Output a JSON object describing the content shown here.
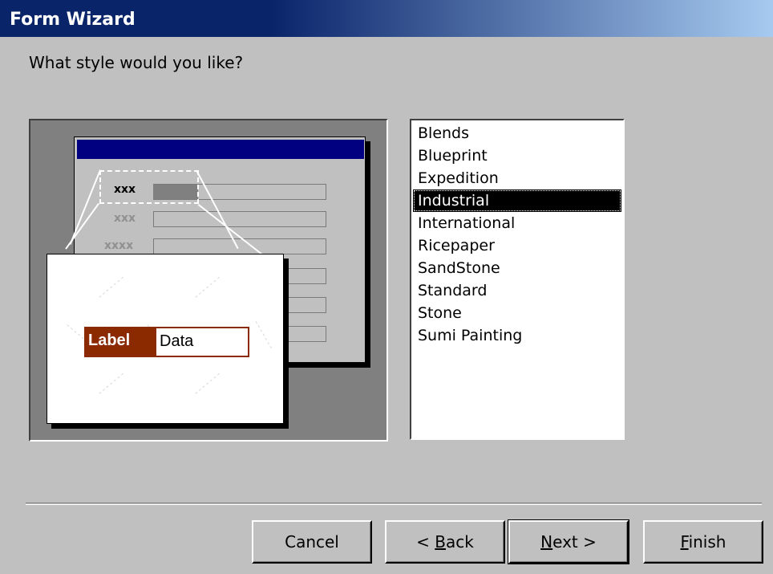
{
  "window": {
    "title": "Form Wizard"
  },
  "prompt": "What style would you like?",
  "preview": {
    "labels": [
      "xxx",
      "xxx",
      "xxxx"
    ],
    "sample_label": "Label",
    "sample_data": "Data",
    "label_color": "#8b2a00"
  },
  "styles": {
    "items": [
      "Blends",
      "Blueprint",
      "Expedition",
      "Industrial",
      "International",
      "Ricepaper",
      "SandStone",
      "Standard",
      "Stone",
      "Sumi Painting"
    ],
    "selected": "Industrial"
  },
  "buttons": {
    "cancel": "Cancel",
    "back_prefix": "< ",
    "back_key": "B",
    "back_rest": "ack",
    "next_key": "N",
    "next_rest": "ext >",
    "finish_key": "F",
    "finish_rest": "inish"
  }
}
